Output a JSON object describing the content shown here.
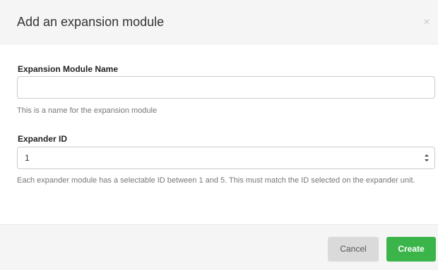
{
  "modal": {
    "title": "Add an expansion module",
    "close_glyph": "×"
  },
  "form": {
    "name_field": {
      "label": "Expansion Module Name",
      "value": "",
      "placeholder": "",
      "help": "This is a name for the expansion module"
    },
    "expander_field": {
      "label": "Expander ID",
      "selected": "1",
      "help": "Each expander module has a selectable ID between 1 and 5. This must match the ID selected on the expander unit."
    }
  },
  "footer": {
    "cancel_label": "Cancel",
    "create_label": "Create"
  },
  "colors": {
    "primary": "#3bb54a",
    "header_bg": "#f5f5f5",
    "cancel_bg": "#dadada"
  }
}
